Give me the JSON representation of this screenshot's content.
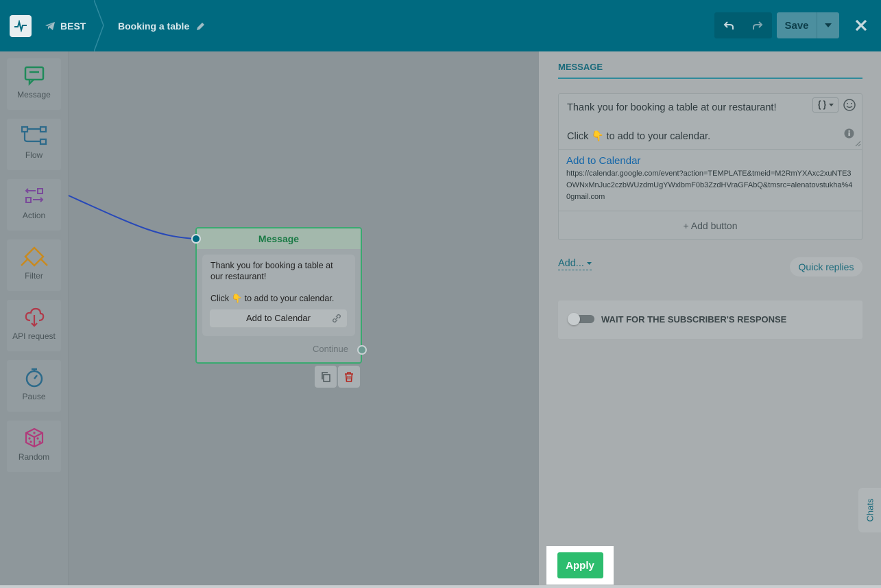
{
  "header": {
    "bot_name": "BEST",
    "flow_name": "Booking a table",
    "save_label": "Save"
  },
  "palette": [
    {
      "label": "Message",
      "icon": "message-icon",
      "color": "#1f8a5a"
    },
    {
      "label": "Flow",
      "icon": "flow-icon",
      "color": "#2d6a8a"
    },
    {
      "label": "Action",
      "icon": "action-icon",
      "color": "#7a4a9a"
    },
    {
      "label": "Filter",
      "icon": "filter-icon",
      "color": "#c98a1e"
    },
    {
      "label": "API request",
      "icon": "api-request-icon",
      "color": "#b03a4a"
    },
    {
      "label": "Pause",
      "icon": "pause-icon",
      "color": "#2d6a8a"
    },
    {
      "label": "Random",
      "icon": "random-icon",
      "color": "#b03a7a"
    }
  ],
  "node": {
    "title": "Message",
    "line1": "Thank you for booking a table at",
    "line2": "our restaurant!",
    "line3_before": "Click",
    "line3_after": "to add to your calendar.",
    "button_label": "Add to Calendar",
    "continue_label": "Continue"
  },
  "panel": {
    "tab_label": "MESSAGE",
    "message_line1": "Thank you for booking a table at our restaurant!",
    "message_line2_before": "Click",
    "message_line2_after": "to add to your calendar.",
    "button_title": "Add to Calendar",
    "button_url": "https://calendar.google.com/event?action=TEMPLATE&tmeid=M2RmYXAxc2xuNTE3OWNxMnJuc2czbWUzdmUgYWxlbmF0b3ZzdHVraGFAbQ&tmsrc=alenatovstukha%40gmail.com",
    "add_button_label": "+ Add button",
    "add_link_label": "Add...",
    "quick_replies_label": "Quick replies",
    "wait_label": "WAIT FOR THE SUBSCRIBER'S RESPONSE",
    "chats_label": "Chats",
    "apply_label": "Apply"
  }
}
